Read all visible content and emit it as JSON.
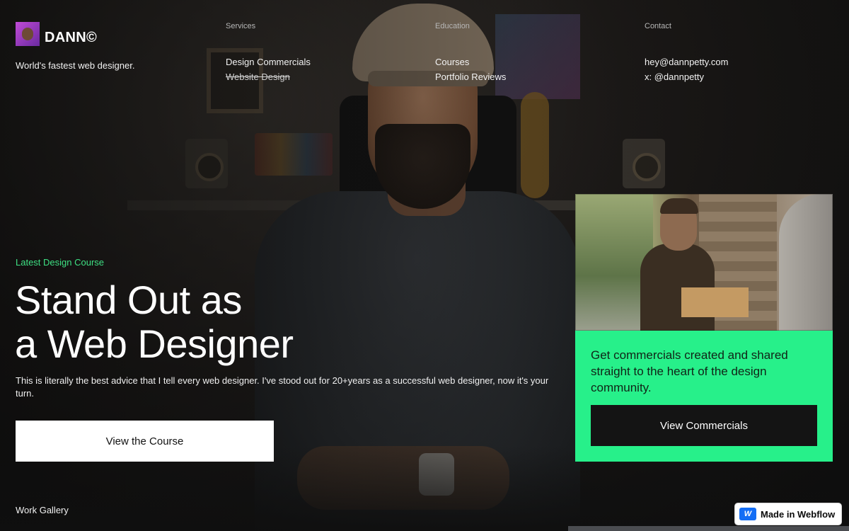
{
  "brand": {
    "name": "DANN©",
    "tagline": "World's fastest web designer."
  },
  "nav": {
    "services": {
      "heading": "Services",
      "links": [
        "Design Commercials",
        "Website Design"
      ]
    },
    "education": {
      "heading": "Education",
      "links": [
        "Courses",
        "Portfolio Reviews"
      ]
    },
    "contact": {
      "heading": "Contact",
      "links": [
        "hey@dannpetty.com",
        "x: @dannpetty"
      ]
    }
  },
  "hero": {
    "eyebrow": "Latest Design Course",
    "title_line1": "Stand Out as",
    "title_line2": "a Web Designer",
    "description": "This is literally the best advice that I tell every web designer. I've stood out for 20+years as a successful web designer, now it's your turn.",
    "cta": "View the Course"
  },
  "promo": {
    "text": "Get commercials created and shared straight to the heart of the design community.",
    "cta": "View Commercials"
  },
  "footer": {
    "gallery_label": "Work Gallery",
    "badge": "Made in Webflow",
    "badge_icon": "webflow-icon"
  },
  "colors": {
    "accent_green": "#27f08a",
    "eyebrow_green": "#3ee083",
    "dark": "#141414"
  }
}
